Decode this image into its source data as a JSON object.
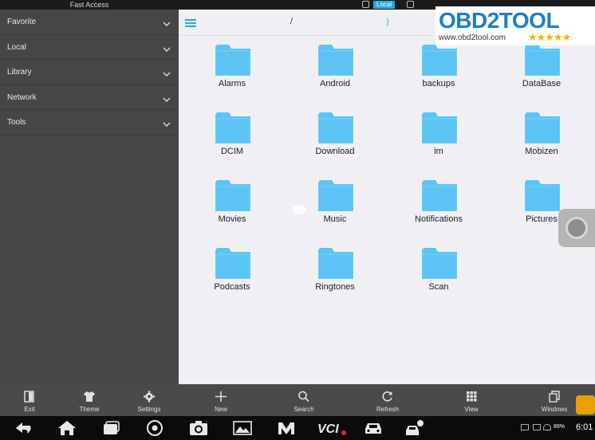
{
  "statusbar": {
    "title": "Fast Access",
    "storage_chip": "Local"
  },
  "sidebar": {
    "items": [
      {
        "label": "Favorite"
      },
      {
        "label": "Local"
      },
      {
        "label": "Library"
      },
      {
        "label": "Network"
      },
      {
        "label": "Tools"
      }
    ]
  },
  "toolbar": {
    "path": "/",
    "forward_glyph": "⟩"
  },
  "files": [
    {
      "name": "Alarms"
    },
    {
      "name": "Android"
    },
    {
      "name": "backups"
    },
    {
      "name": "DataBase"
    },
    {
      "name": "DCIM"
    },
    {
      "name": "Download"
    },
    {
      "name": "im"
    },
    {
      "name": "Mobizen"
    },
    {
      "name": "Movies"
    },
    {
      "name": "Music"
    },
    {
      "name": "Notifications"
    },
    {
      "name": "Pictures"
    },
    {
      "name": "Podcasts"
    },
    {
      "name": "Ringtones"
    },
    {
      "name": "Scan"
    }
  ],
  "folder_color": "#5bc4f5",
  "watermark": {
    "brand": "OBD2TOOL",
    "url": "www.obd2tool.com",
    "stars": "★★★★★"
  },
  "actions": [
    {
      "label": "Exit",
      "icon": "exit-icon"
    },
    {
      "label": "Theme",
      "icon": "shirt-icon"
    },
    {
      "label": "Settings",
      "icon": "gear-icon"
    },
    {
      "label": "New",
      "icon": "plus-icon"
    },
    {
      "label": "Search",
      "icon": "search-icon"
    },
    {
      "label": "Refresh",
      "icon": "refresh-icon"
    },
    {
      "label": "View",
      "icon": "grid-icon"
    },
    {
      "label": "Windows",
      "icon": "windows-icon"
    }
  ],
  "navbar": {
    "battery": "89%",
    "time": "6:01",
    "icons": [
      "back-icon",
      "home-icon",
      "recents-icon",
      "chrome-icon",
      "camera-icon",
      "gallery-icon",
      "m-app-icon",
      "vci-icon",
      "car-icon",
      "car-person-icon"
    ]
  }
}
